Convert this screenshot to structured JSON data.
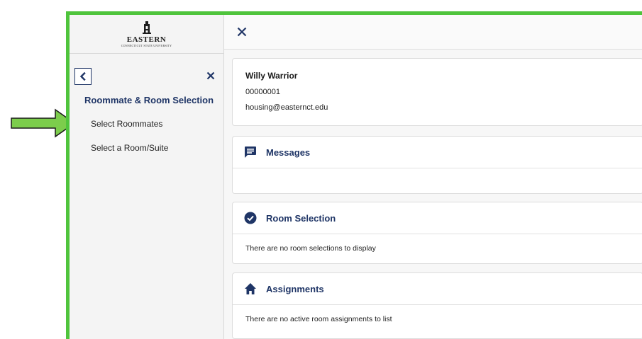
{
  "colors": {
    "frame": "#4fc43c",
    "accent": "#1f3566",
    "arrow": "#7ccd4c"
  },
  "sidebar": {
    "logo": {
      "name": "EASTERN",
      "subtitle": "CONNECTICUT STATE UNIVERSITY"
    },
    "back_icon": "chevron-left-icon",
    "close_icon": "close-icon",
    "section_title": "Roommate & Room Selection",
    "items": [
      {
        "label": "Select Roommates"
      },
      {
        "label": "Select a Room/Suite"
      }
    ]
  },
  "main": {
    "close_icon": "close-icon",
    "profile": {
      "name": "Willy Warrior",
      "id": "00000001",
      "email": "housing@easternct.edu"
    },
    "cards": [
      {
        "icon": "message-icon",
        "title": "Messages",
        "body": ""
      },
      {
        "icon": "check-circle-icon",
        "title": "Room Selection",
        "body": "There are no room selections to display"
      },
      {
        "icon": "home-icon",
        "title": "Assignments",
        "body": "There are no active room assignments to list"
      }
    ]
  }
}
